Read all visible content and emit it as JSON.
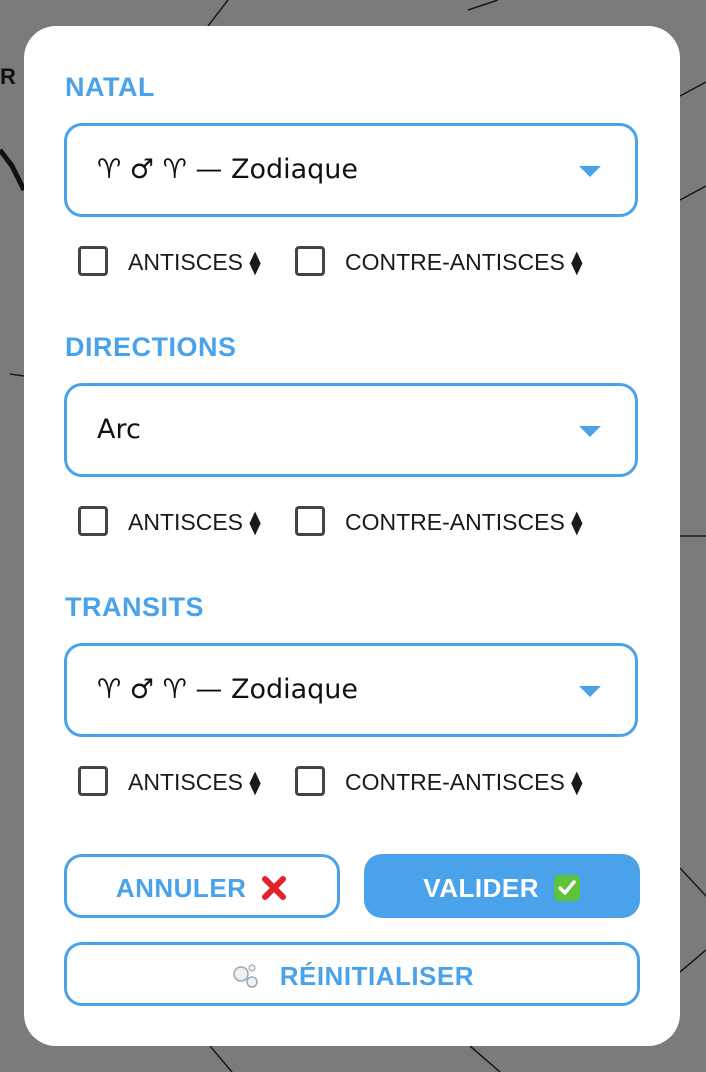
{
  "background": {
    "corner_text": "R"
  },
  "sections": [
    {
      "title": "NATAL",
      "selected": "♈︎ ♂ ♈ — Zodiaque",
      "checkboxes": [
        {
          "label": "ANTISCES ⧫",
          "checked": false
        },
        {
          "label": "CONTRE-ANTISCES ⧫",
          "checked": false
        }
      ]
    },
    {
      "title": "DIRECTIONS",
      "selected": "Arc",
      "checkboxes": [
        {
          "label": "ANTISCES ⧫",
          "checked": false
        },
        {
          "label": "CONTRE-ANTISCES ⧫",
          "checked": false
        }
      ]
    },
    {
      "title": "TRANSITS",
      "selected": "♈︎ ♂ ♈ — Zodiaque",
      "checkboxes": [
        {
          "label": "ANTISCES ⧫",
          "checked": false
        },
        {
          "label": "CONTRE-ANTISCES ⧫",
          "checked": false
        }
      ]
    }
  ],
  "buttons": {
    "cancel": "ANNULER",
    "confirm": "VALIDER",
    "reset": "RÉINITIALISER"
  },
  "colors": {
    "accent": "#4aa3ea",
    "overlay": "#7b7b7b",
    "cancel_icon": "#e0242a",
    "confirm_icon": "#5cc33a"
  },
  "icons": {
    "cancel": "cross-mark-icon",
    "confirm": "check-mark-icon",
    "reset": "bubbles-icon",
    "dropdown": "caret-down-icon"
  }
}
